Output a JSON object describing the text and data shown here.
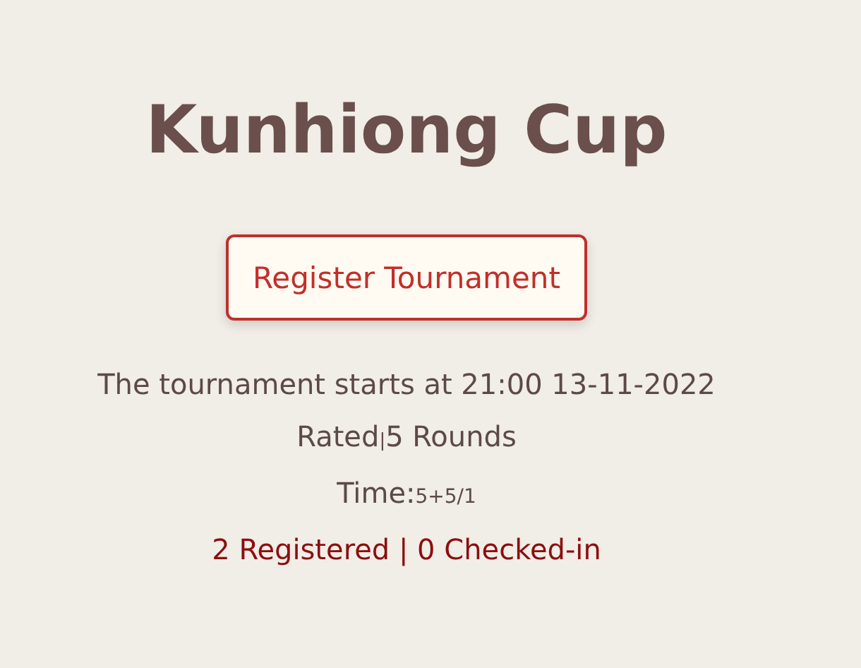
{
  "title": "Kunhiong Cup",
  "register_button": {
    "label": "Register Tournament"
  },
  "start_line": "The tournament starts at 21:00 13-11-2022",
  "format": {
    "rated": "Rated",
    "separator": "|",
    "rounds": "5 Rounds"
  },
  "time_control": {
    "label": "Time:",
    "value": "5+5/1"
  },
  "registration_status": "2 Registered | 0 Checked-in"
}
